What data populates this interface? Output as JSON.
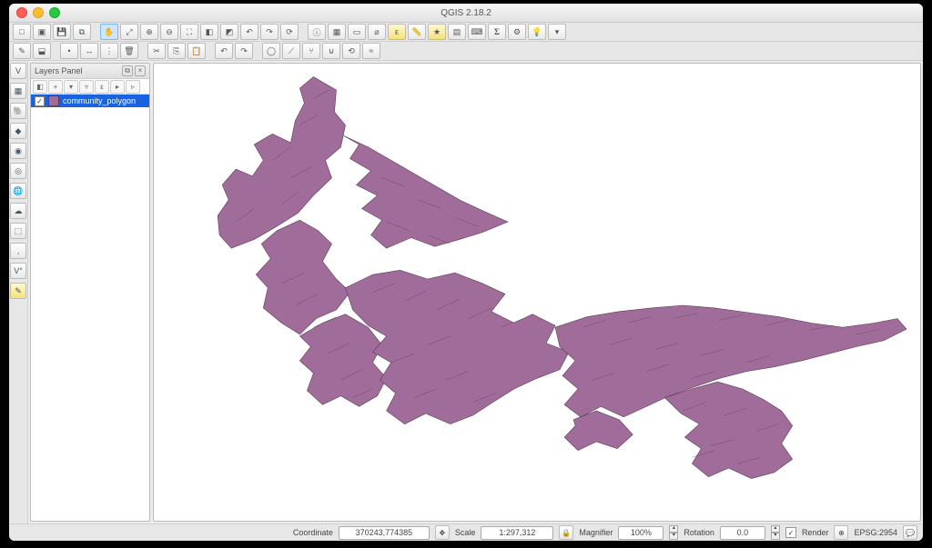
{
  "window": {
    "title": "QGIS 2.18.2"
  },
  "layers_panel": {
    "title": "Layers Panel",
    "layer_name": "community_polygon"
  },
  "status": {
    "coord_label": "Coordinate",
    "coord_value": "370243,774385",
    "scale_label": "Scale",
    "scale_value": "1:297,312",
    "magnifier_label": "Magnifier",
    "magnifier_value": "100%",
    "rotation_label": "Rotation",
    "rotation_value": "0.0",
    "render_label": "Render",
    "crs_label": "EPSG:2954"
  },
  "colors": {
    "polygon_fill": "#a06c99",
    "polygon_stroke": "#5f3a58"
  }
}
